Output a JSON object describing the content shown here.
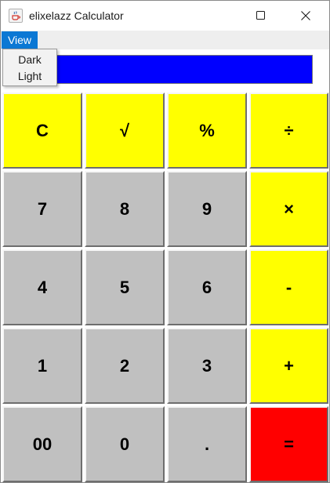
{
  "window": {
    "title": "elixelazz Calculator",
    "icon": "java-cup-icon",
    "controls": [
      "minimize-icon",
      "maximize-icon",
      "close-icon"
    ]
  },
  "menubar": {
    "view_label": "View"
  },
  "view_menu": {
    "items": [
      "Dark",
      "Light"
    ]
  },
  "display": {
    "value": "",
    "background": "#0000ff"
  },
  "colors": {
    "operator": "#ffff00",
    "digit": "#c0c0c0",
    "equals": "#ff0000"
  },
  "keys": [
    [
      "C",
      "√",
      "%",
      "÷"
    ],
    [
      "7",
      "8",
      "9",
      "×"
    ],
    [
      "4",
      "5",
      "6",
      "-"
    ],
    [
      "1",
      "2",
      "3",
      "+"
    ],
    [
      "00",
      "0",
      ".",
      "="
    ]
  ]
}
